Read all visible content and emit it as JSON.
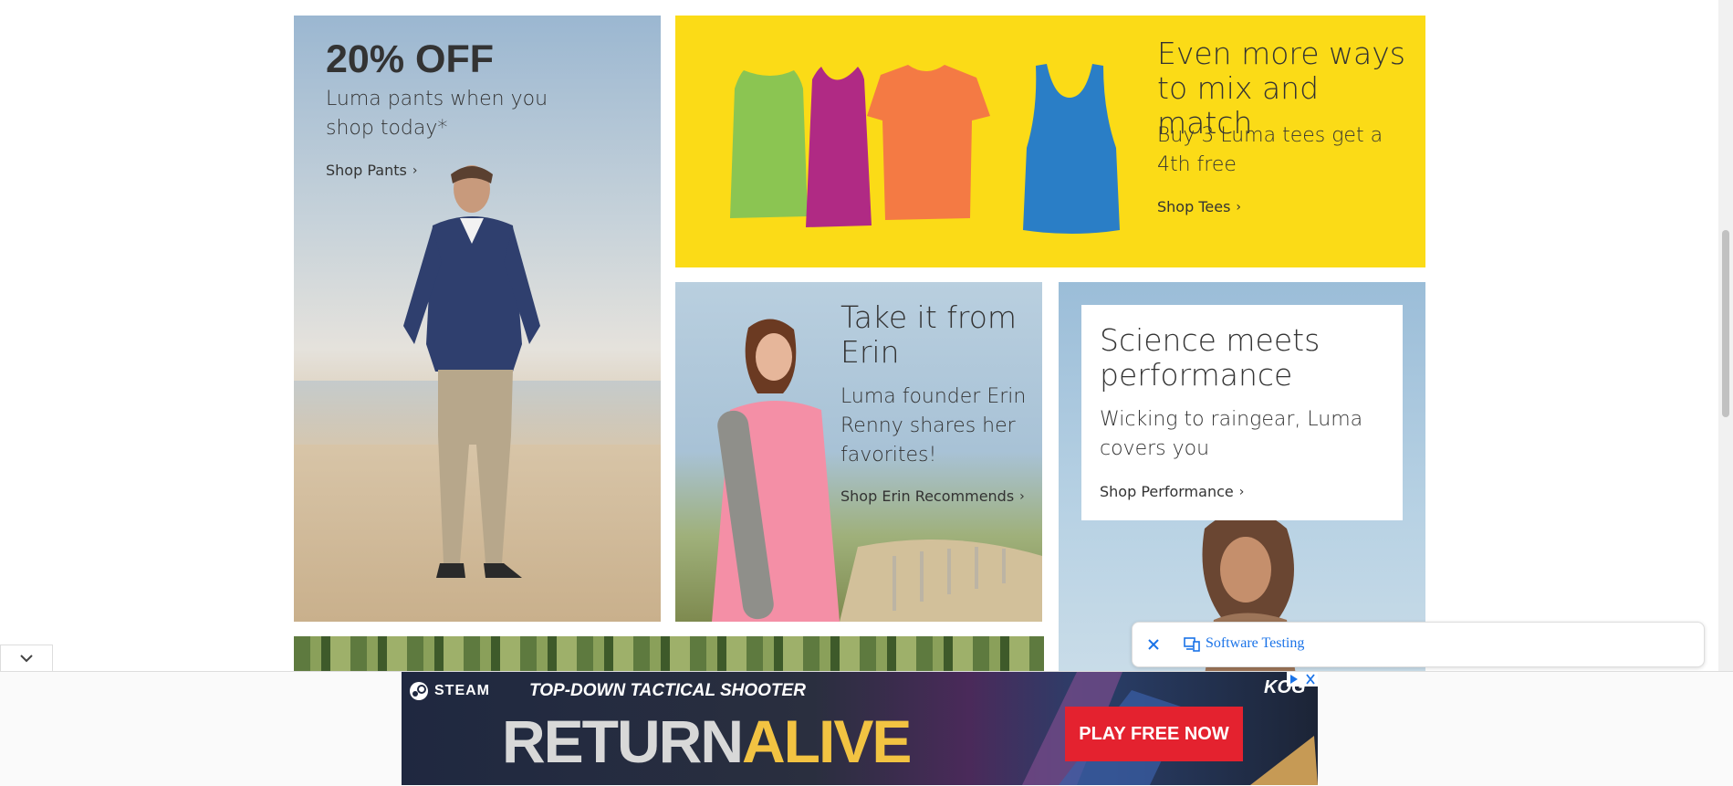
{
  "tiles": {
    "pants": {
      "headline": "20% OFF",
      "body": "Luma pants when you shop today*",
      "link": "Shop Pants"
    },
    "tees": {
      "headline": "Even more ways to mix and match",
      "body": "Buy 3 Luma tees get a 4th free",
      "link": "Shop Tees"
    },
    "erin": {
      "headline": "Take it from Erin",
      "body": "Luma founder Erin Renny shares her favorites!",
      "link": "Shop Erin Recommends"
    },
    "performance": {
      "headline": "Science meets performance",
      "body": "Wicking to raingear, Luma covers you",
      "link": "Shop Performance"
    }
  },
  "toast": {
    "label": "Software Testing"
  },
  "ad": {
    "brand": "STEAM",
    "tagline": "TOP-DOWN TACTICAL SHOOTER",
    "title_left": "RETURN",
    "title_right": "ALIVE",
    "cta": "PLAY FREE NOW",
    "publisher": "KOG"
  },
  "colors": {
    "tees_bg": "#fbdb17",
    "shirt_green": "#8bc552",
    "shirt_magenta": "#b02a84",
    "shirt_orange": "#f47a44",
    "tank_blue": "#2a7ec6",
    "ad_cta": "#e4222f",
    "link_blue": "#1a73e8"
  }
}
